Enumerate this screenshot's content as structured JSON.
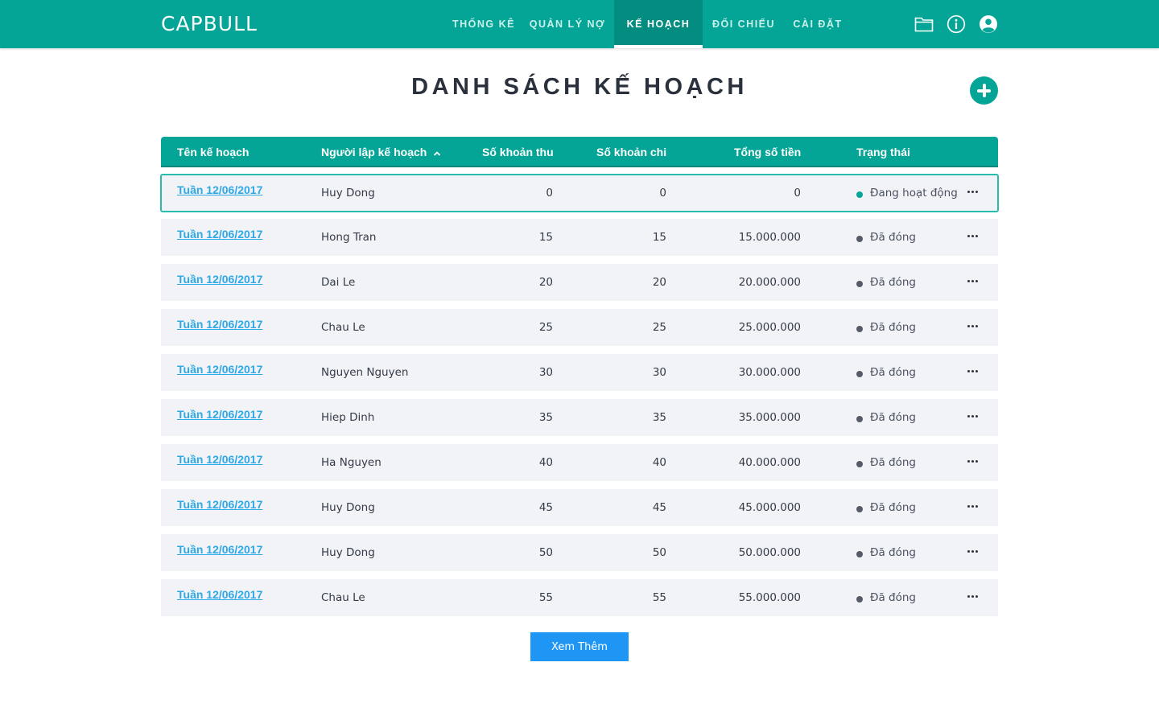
{
  "app": {
    "logo": "CAPBULL",
    "accent_color": "#04a597",
    "nav": [
      {
        "label": "THỐNG KÊ",
        "active": false
      },
      {
        "label": "QUẢN LÝ NỢ",
        "active": false
      },
      {
        "label": "KẾ HOẠCH",
        "active": true
      },
      {
        "label": "ĐỐI CHIẾU",
        "active": false
      },
      {
        "label": "CÀI ĐẶT",
        "active": false
      }
    ],
    "top_icons": [
      "folder-icon",
      "info-icon",
      "user-icon"
    ]
  },
  "page": {
    "title": "DANH SÁCH KẾ HOẠCH",
    "add_icon": "plus-icon"
  },
  "table": {
    "columns": [
      {
        "label": "Tên kế hoạch"
      },
      {
        "label": "Người lập kế hoạch",
        "sort": "ascending"
      },
      {
        "label": "Số khoản thu"
      },
      {
        "label": "Số khoản chi"
      },
      {
        "label": "Tổng số tiền"
      },
      {
        "label": "Trạng thái"
      }
    ],
    "status_colors": {
      "active": "#04a597",
      "closed": "#555b66"
    },
    "rows": [
      {
        "name": "Tuần 12/06/2017",
        "creator": "Huy Dong",
        "income": "0",
        "expense": "0",
        "total": "0",
        "status": "Đang hoạt động",
        "state": "active",
        "selected": true
      },
      {
        "name": "Tuần 12/06/2017",
        "creator": "Hong Tran",
        "income": "15",
        "expense": "15",
        "total": "15.000.000",
        "status": "Đã đóng",
        "state": "closed"
      },
      {
        "name": "Tuần 12/06/2017",
        "creator": "Dai Le",
        "income": "20",
        "expense": "20",
        "total": "20.000.000",
        "status": "Đã đóng",
        "state": "closed"
      },
      {
        "name": "Tuần 12/06/2017",
        "creator": "Chau Le",
        "income": "25",
        "expense": "25",
        "total": "25.000.000",
        "status": "Đã đóng",
        "state": "closed"
      },
      {
        "name": "Tuần 12/06/2017",
        "creator": "Nguyen Nguyen",
        "income": "30",
        "expense": "30",
        "total": "30.000.000",
        "status": "Đã đóng",
        "state": "closed"
      },
      {
        "name": "Tuần 12/06/2017",
        "creator": "Hiep Dinh",
        "income": "35",
        "expense": "35",
        "total": "35.000.000",
        "status": "Đã đóng",
        "state": "closed"
      },
      {
        "name": "Tuần 12/06/2017",
        "creator": "Ha Nguyen",
        "income": "40",
        "expense": "40",
        "total": "40.000.000",
        "status": "Đã đóng",
        "state": "closed"
      },
      {
        "name": "Tuần 12/06/2017",
        "creator": "Huy Dong",
        "income": "45",
        "expense": "45",
        "total": "45.000.000",
        "status": "Đã đóng",
        "state": "closed"
      },
      {
        "name": "Tuần 12/06/2017",
        "creator": "Huy Dong",
        "income": "50",
        "expense": "50",
        "total": "50.000.000",
        "status": "Đã đóng",
        "state": "closed"
      },
      {
        "name": "Tuần 12/06/2017",
        "creator": "Chau Le",
        "income": "55",
        "expense": "55",
        "total": "55.000.000",
        "status": "Đã đóng",
        "state": "closed"
      }
    ]
  },
  "load_more_label": "Xem Thêm"
}
